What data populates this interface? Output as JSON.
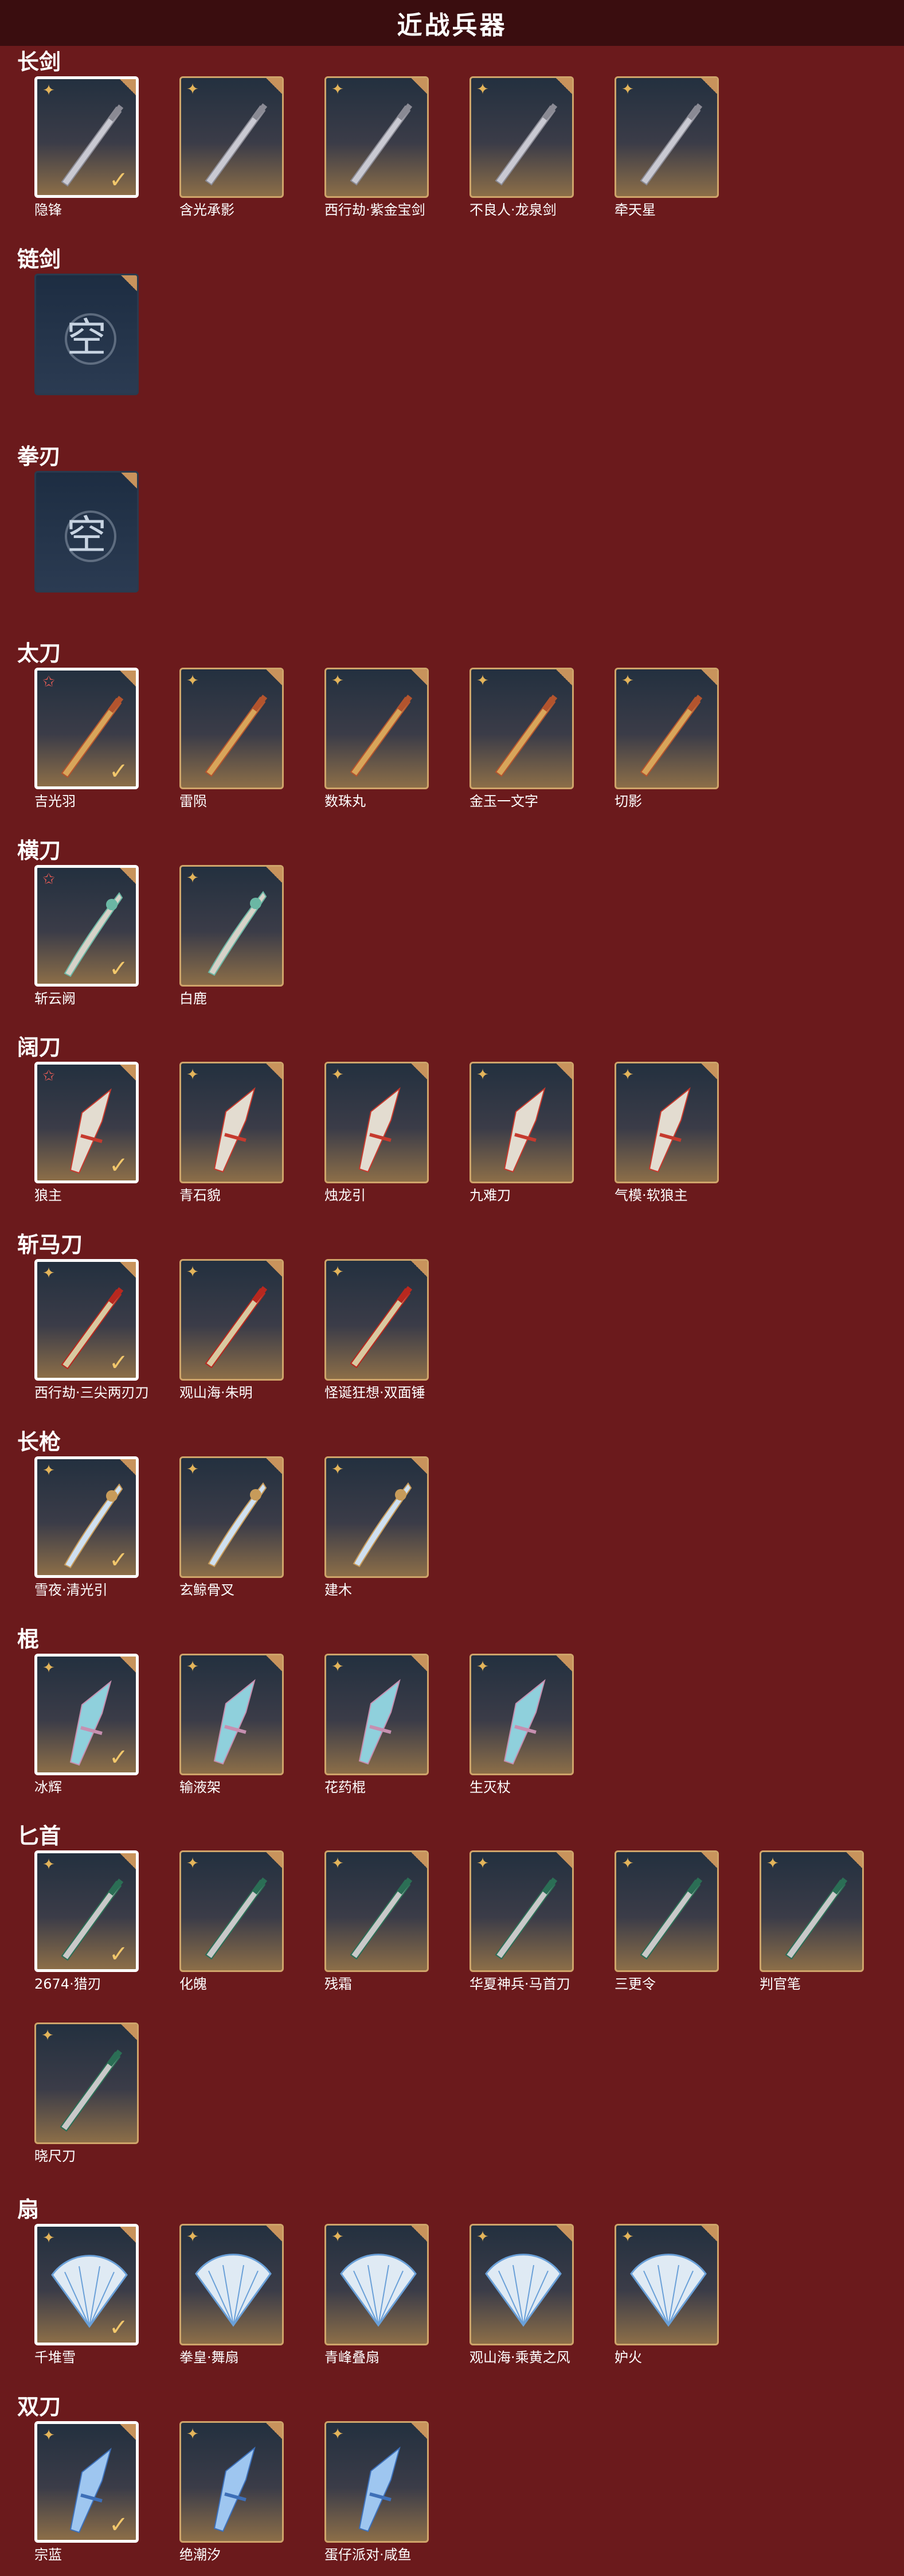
{
  "page": {
    "title": "近战兵器"
  },
  "sections": [
    {
      "label": "长剑",
      "items": [
        {
          "name": "隐锋",
          "rank": "gold",
          "selected": true
        },
        {
          "name": "含光承影",
          "rank": "gold",
          "selected": false
        },
        {
          "name": "西行劫·紫金宝剑",
          "rank": "gold",
          "selected": false
        },
        {
          "name": "不良人·龙泉剑",
          "rank": "gold",
          "selected": false
        },
        {
          "name": "牵天星",
          "rank": "gold",
          "selected": false
        }
      ]
    },
    {
      "label": "链剑",
      "items": [
        {
          "name": "",
          "empty": true,
          "empty_text": "空"
        }
      ]
    },
    {
      "label": "拳刃",
      "items": [
        {
          "name": "",
          "empty": true,
          "empty_text": "空"
        }
      ]
    },
    {
      "label": "太刀",
      "items": [
        {
          "name": "吉光羽",
          "rank": "red",
          "selected": true
        },
        {
          "name": "雷陨",
          "rank": "gold",
          "selected": false
        },
        {
          "name": "数珠丸",
          "rank": "gold",
          "selected": false
        },
        {
          "name": "金玉一文字",
          "rank": "gold",
          "selected": false
        },
        {
          "name": "切影",
          "rank": "gold",
          "selected": false
        }
      ]
    },
    {
      "label": "横刀",
      "items": [
        {
          "name": "斩云阙",
          "rank": "red",
          "selected": true
        },
        {
          "name": "白鹿",
          "rank": "gold",
          "selected": false
        }
      ]
    },
    {
      "label": "阔刀",
      "items": [
        {
          "name": "狼主",
          "rank": "red",
          "selected": true
        },
        {
          "name": "青石貌",
          "rank": "gold",
          "selected": false
        },
        {
          "name": "烛龙引",
          "rank": "gold",
          "selected": false
        },
        {
          "name": "九难刀",
          "rank": "gold",
          "selected": false
        },
        {
          "name": "气模·软狼主",
          "rank": "gold",
          "selected": false
        }
      ]
    },
    {
      "label": "斩马刀",
      "items": [
        {
          "name": "西行劫·三尖两刃刀",
          "rank": "gold",
          "selected": true
        },
        {
          "name": "观山海·朱明",
          "rank": "gold",
          "selected": false
        },
        {
          "name": "怪诞狂想·双面锤",
          "rank": "gold",
          "selected": false
        }
      ]
    },
    {
      "label": "长枪",
      "items": [
        {
          "name": "雪夜·清光引",
          "rank": "gold",
          "selected": true
        },
        {
          "name": "玄鲸骨叉",
          "rank": "gold",
          "selected": false
        },
        {
          "name": "建木",
          "rank": "gold",
          "selected": false
        }
      ]
    },
    {
      "label": "棍",
      "items": [
        {
          "name": "冰辉",
          "rank": "gold",
          "selected": true
        },
        {
          "name": "输液架",
          "rank": "gold",
          "selected": false
        },
        {
          "name": "花药棍",
          "rank": "gold",
          "selected": false
        },
        {
          "name": "生灭杖",
          "rank": "gold",
          "selected": false
        }
      ]
    },
    {
      "label": "匕首",
      "items": [
        {
          "name": "2674·猎刃",
          "rank": "gold",
          "selected": true
        },
        {
          "name": "化魄",
          "rank": "gold",
          "selected": false
        },
        {
          "name": "残霜",
          "rank": "gold",
          "selected": false
        },
        {
          "name": "华夏神兵·马首刀",
          "rank": "gold",
          "selected": false
        },
        {
          "name": "三更令",
          "rank": "gold",
          "selected": false
        },
        {
          "name": "判官笔",
          "rank": "gold",
          "selected": false
        },
        {
          "name": "晓尺刀",
          "rank": "gold",
          "selected": false
        }
      ]
    },
    {
      "label": "扇",
      "items": [
        {
          "name": "千堆雪",
          "rank": "gold",
          "selected": true
        },
        {
          "name": "拳皇·舞扇",
          "rank": "gold",
          "selected": false
        },
        {
          "name": "青峰叠扇",
          "rank": "gold",
          "selected": false
        },
        {
          "name": "观山海·乘黄之风",
          "rank": "gold",
          "selected": false
        },
        {
          "name": "妒火",
          "rank": "gold",
          "selected": false
        }
      ]
    },
    {
      "label": "双刀",
      "items": [
        {
          "name": "宗蓝",
          "rank": "gold",
          "selected": true
        },
        {
          "name": "绝潮汐",
          "rank": "gold",
          "selected": false
        },
        {
          "name": "蛋仔派对·咸鱼",
          "rank": "gold",
          "selected": false
        }
      ]
    }
  ],
  "colors": {
    "background": "#6b1a1c",
    "header": "#3a0d0f",
    "frame": "#cfa46a",
    "check": "#f2c76b"
  },
  "icons": {
    "rank_gold": "sparkle-icon",
    "rank_red": "star-icon",
    "selected": "check-icon"
  }
}
